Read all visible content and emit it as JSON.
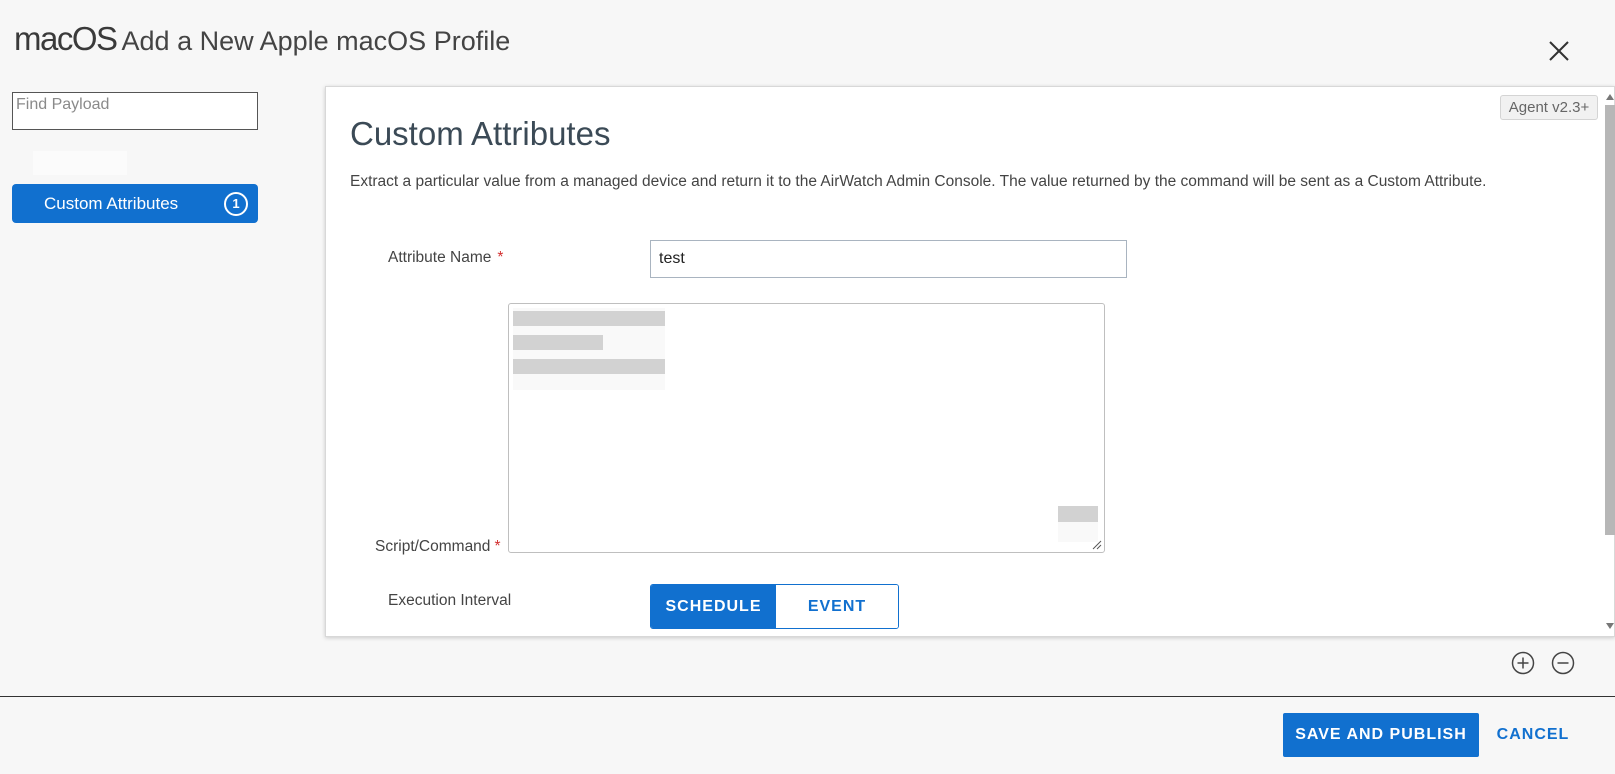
{
  "header": {
    "logo": "macOS",
    "title": "Add a New Apple macOS Profile"
  },
  "sidebar": {
    "search_placeholder": "Find Payload",
    "items": [
      {
        "label": "Custom Attributes",
        "count": "1"
      }
    ]
  },
  "panel": {
    "agent_tag": "Agent v2.3+",
    "title": "Custom Attributes",
    "description": "Extract a particular value from a managed device and return it to the AirWatch Admin Console. The value returned by the command will be sent as a Custom Attribute.",
    "fields": {
      "attribute_name_label": "Attribute Name",
      "attribute_name_value": "test",
      "script_label": "Script/Command",
      "execution_interval_label": "Execution Interval",
      "required_marker": "*"
    },
    "interval_options": [
      "SCHEDULE",
      "EVENT"
    ],
    "interval_selected": "SCHEDULE"
  },
  "footer": {
    "save_label": "SAVE AND PUBLISH",
    "cancel_label": "CANCEL"
  },
  "icons": {
    "close": "close-icon",
    "add": "plus-circle-icon",
    "remove": "minus-circle-icon"
  },
  "colors": {
    "accent": "#1170cf",
    "required": "#d32f2f"
  }
}
